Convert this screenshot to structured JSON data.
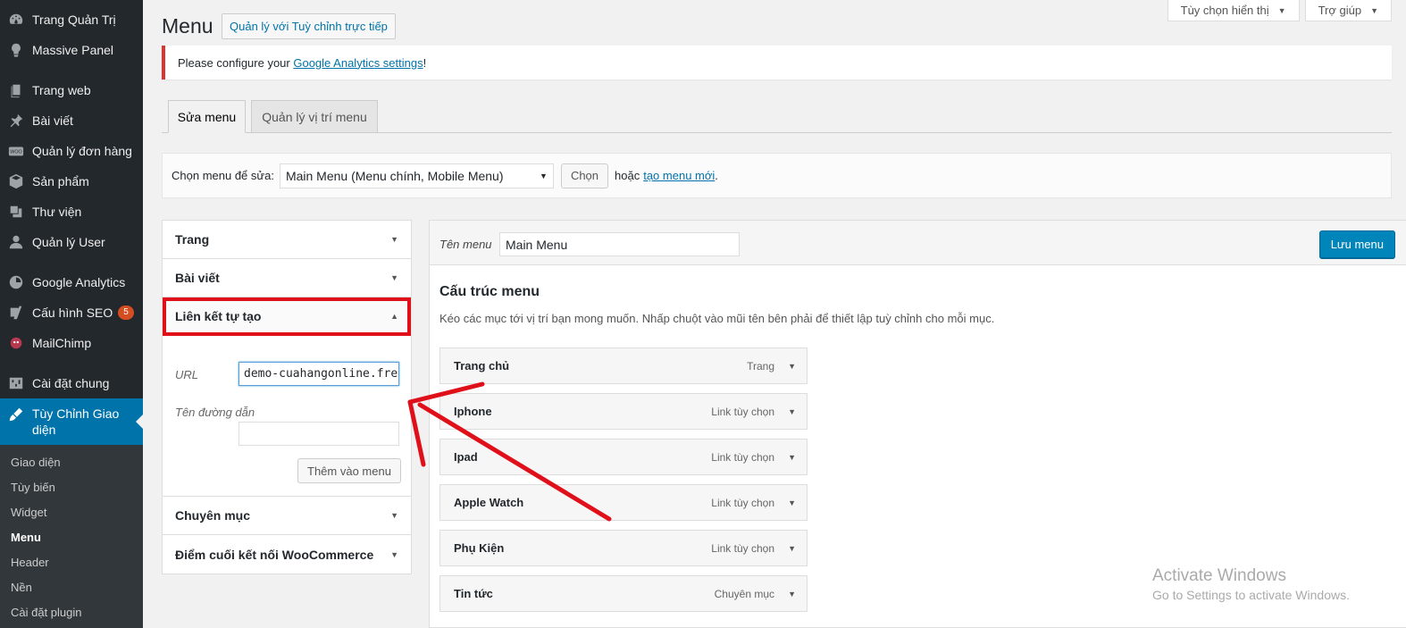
{
  "sidebar": {
    "items": [
      {
        "label": "Trang Quản Trị",
        "icon": "dashboard-icon"
      },
      {
        "label": "Massive Panel",
        "icon": "lightbulb-icon"
      },
      {
        "label": "Trang web",
        "icon": "pages-icon"
      },
      {
        "label": "Bài viết",
        "icon": "pin-icon"
      },
      {
        "label": "Quản lý đơn hàng",
        "icon": "woo-icon"
      },
      {
        "label": "Sản phẩm",
        "icon": "box-icon"
      },
      {
        "label": "Thư viện",
        "icon": "media-icon"
      },
      {
        "label": "Quản lý User",
        "icon": "user-icon"
      },
      {
        "label": "Google Analytics",
        "icon": "analytics-icon"
      },
      {
        "label": "Cấu hình SEO",
        "icon": "yoast-icon",
        "badge": "5"
      },
      {
        "label": "MailChimp",
        "icon": "mailchimp-icon"
      },
      {
        "label": "Cài đặt chung",
        "icon": "settings-icon"
      },
      {
        "label": "Tùy Chỉnh Giao diện",
        "icon": "brush-icon"
      }
    ],
    "submenu": [
      "Giao diện",
      "Tùy biến",
      "Widget",
      "Menu",
      "Header",
      "Nền",
      "Cài đặt plugin"
    ]
  },
  "top": {
    "screen_options": "Tùy chọn hiển thị",
    "help": "Trợ giúp"
  },
  "page": {
    "title": "Menu",
    "live_button": "Quản lý với Tuỳ chỉnh trực tiếp"
  },
  "notice": {
    "prefix": "Please configure your ",
    "link": "Google Analytics settings",
    "suffix": "!"
  },
  "tabs": [
    "Sửa menu",
    "Quản lý vị trí menu"
  ],
  "manage": {
    "label": "Chọn menu để sửa:",
    "selected": "Main Menu (Menu chính, Mobile Menu)",
    "choose_button": "Chọn",
    "or": "hoặc",
    "create_link": "tạo menu mới",
    "period": "."
  },
  "accordion": {
    "sections": [
      "Trang",
      "Bài viết",
      "Liên kết tự tạo",
      "Chuyên mục",
      "Điểm cuối kết nối WooCommerce"
    ],
    "custom_link": {
      "url_label": "URL",
      "url_value": "demo-cuahangonline.fre",
      "text_label": "Tên đường dẫn",
      "text_value": "",
      "add_button": "Thêm vào menu"
    }
  },
  "menu": {
    "name_label": "Tên menu",
    "name_value": "Main Menu",
    "save_button": "Lưu menu",
    "structure_title": "Cấu trúc menu",
    "structure_desc": "Kéo các mục tới vị trí bạn mong muốn. Nhấp chuột vào mũi tên bên phải để thiết lập tuỳ chỉnh cho mỗi mục.",
    "items": [
      {
        "title": "Trang chủ",
        "type": "Trang"
      },
      {
        "title": "Iphone",
        "type": "Link tùy chọn"
      },
      {
        "title": "Ipad",
        "type": "Link tùy chọn"
      },
      {
        "title": "Apple Watch",
        "type": "Link tùy chọn"
      },
      {
        "title": "Phụ Kiện",
        "type": "Link tùy chọn"
      },
      {
        "title": "Tin tức",
        "type": "Chuyên mục"
      }
    ]
  },
  "watermark": {
    "line1": "Activate Windows",
    "line2": "Go to Settings to activate Windows."
  },
  "colors": {
    "sidebar_bg": "#23282d",
    "active_bg": "#0073aa",
    "primary_button": "#0085ba",
    "highlight": "#e0101b"
  }
}
